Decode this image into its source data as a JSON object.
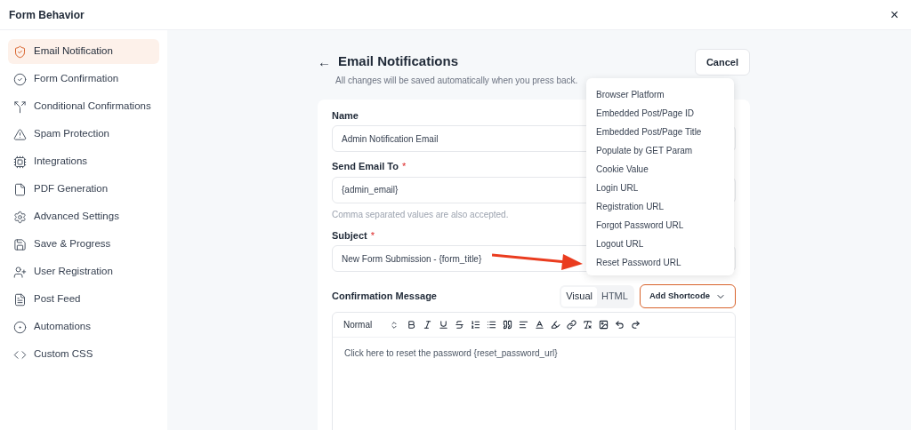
{
  "window": {
    "title": "Form Behavior",
    "close": "×"
  },
  "sidebar": {
    "items": [
      {
        "label": "Email Notification",
        "selected": true
      },
      {
        "label": "Form Confirmation",
        "selected": false
      },
      {
        "label": "Conditional Confirmations",
        "selected": false
      },
      {
        "label": "Spam Protection",
        "selected": false
      },
      {
        "label": "Integrations",
        "selected": false
      },
      {
        "label": "PDF Generation",
        "selected": false
      },
      {
        "label": "Advanced Settings",
        "selected": false
      },
      {
        "label": "Save & Progress",
        "selected": false
      },
      {
        "label": "User Registration",
        "selected": false
      },
      {
        "label": "Post Feed",
        "selected": false
      },
      {
        "label": "Automations",
        "selected": false
      },
      {
        "label": "Custom CSS",
        "selected": false
      }
    ]
  },
  "header": {
    "back": "←",
    "title": "Email Notifications",
    "subtitle": "All changes will be saved automatically when you press back.",
    "cancel": "Cancel"
  },
  "fields": [
    {
      "label": "Name",
      "value": "Admin Notification Email"
    },
    {
      "label": "Send Email To",
      "required_mark": "*",
      "value": "{admin_email}",
      "hint": "Comma separated values are also accepted."
    },
    {
      "label": "Subject",
      "required_mark": "*",
      "value": "New Form Submission - {form_title}"
    }
  ],
  "message": {
    "label": "Confirmation Message",
    "modes": [
      {
        "label": "Visual",
        "selected": true
      },
      {
        "label": "HTML",
        "selected": false
      }
    ],
    "shortcode": "Add Shortcode",
    "format": "Normal",
    "body": "Click here to reset the password {reset_password_url}"
  },
  "shortcode_menu": {
    "items": [
      "Browser Platform",
      "Embedded Post/Page ID",
      "Embedded Post/Page Title",
      "Populate by GET Param",
      "Cookie Value",
      "Login URL",
      "Registration URL",
      "Forgot Password URL",
      "Logout URL",
      "Reset Password URL"
    ]
  }
}
